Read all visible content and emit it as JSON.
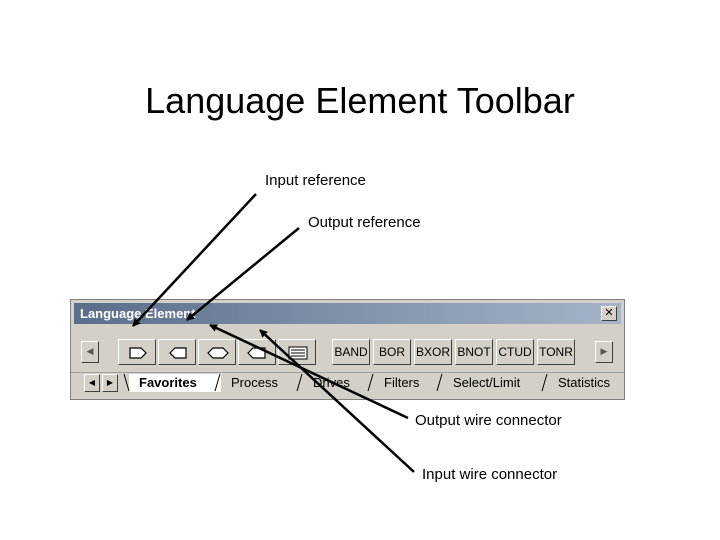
{
  "slide": {
    "title": "Language Element Toolbar",
    "callouts": {
      "input_reference": "Input reference",
      "output_reference": "Output reference",
      "output_wire_connector": "Output wire connector",
      "input_wire_connector": "Input wire connector"
    }
  },
  "window": {
    "title": "Language Element",
    "close_glyph": "✕"
  },
  "toolbar": {
    "scroll_left_glyph": "◀",
    "scroll_right_glyph": "▶",
    "icon_buttons": [
      {
        "icon": "input-reference-icon"
      },
      {
        "icon": "output-reference-icon"
      },
      {
        "icon": "output-wire-connector-icon"
      },
      {
        "icon": "input-wire-connector-icon"
      },
      {
        "icon": "text-block-icon"
      }
    ],
    "text_buttons": [
      "BAND",
      "BOR",
      "BXOR",
      "BNOT",
      "CTUD",
      "TONR"
    ]
  },
  "tabs": {
    "first_glyph": "◀",
    "next_glyph": "▶",
    "active": "Favorites",
    "items": [
      "Favorites",
      "Process",
      "Drives",
      "Filters",
      "Select/Limit",
      "Statistics"
    ]
  }
}
